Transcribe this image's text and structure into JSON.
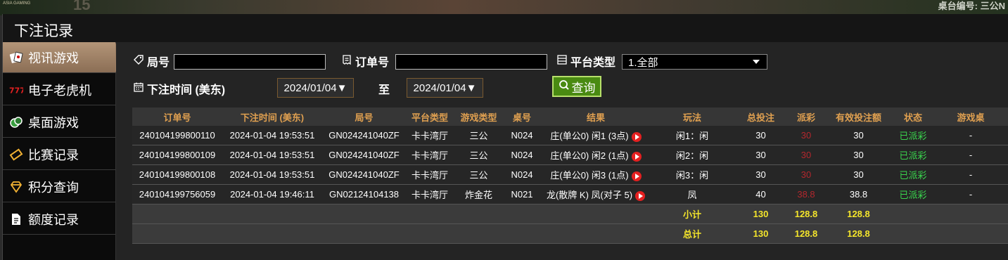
{
  "background": {
    "left_text": "ASIA GAMING",
    "number": "15",
    "right_text": "桌台编号: 三公N"
  },
  "window": {
    "title": "下注记录"
  },
  "sidebar": {
    "items": [
      {
        "label": "视讯游戏",
        "icon": "cards-icon",
        "active": true
      },
      {
        "label": "电子老虎机",
        "icon": "slot-777-icon",
        "active": false
      },
      {
        "label": "桌面游戏",
        "icon": "chip-icon",
        "active": false
      },
      {
        "label": "比赛记录",
        "icon": "ticket-icon",
        "active": false
      },
      {
        "label": "积分查询",
        "icon": "diamond-icon",
        "active": false
      },
      {
        "label": "额度记录",
        "icon": "document-icon",
        "active": false
      }
    ]
  },
  "filters": {
    "round_label": "局号",
    "round_value": "",
    "order_label": "订单号",
    "order_value": "",
    "platform_label": "平台类型",
    "platform_value": "1.全部",
    "time_label": "下注时间 (美东)",
    "date_from": "2024/01/04",
    "to_label": "至",
    "date_to": "2024/01/04",
    "query_label": "查询"
  },
  "table": {
    "headers": [
      "订单号",
      "下注时间 (美东)",
      "局号",
      "平台类型",
      "游戏类型",
      "桌号",
      "结果",
      "玩法",
      "总投注",
      "派彩",
      "有效投注额",
      "状态",
      "游戏桌"
    ],
    "rows": [
      [
        "240104199800110",
        "2024-01-04 19:53:51",
        "GN024241040ZF",
        "卡卡湾厅",
        "三公",
        "N024",
        "庄(单公0) 闲1 (3点)",
        "闲1：闲",
        "30",
        "30",
        "30",
        "已派彩",
        "-"
      ],
      [
        "240104199800109",
        "2024-01-04 19:53:51",
        "GN024241040ZF",
        "卡卡湾厅",
        "三公",
        "N024",
        "庄(单公0) 闲2 (1点)",
        "闲2：闲",
        "30",
        "30",
        "30",
        "已派彩",
        "-"
      ],
      [
        "240104199800108",
        "2024-01-04 19:53:51",
        "GN024241040ZF",
        "卡卡湾厅",
        "三公",
        "N024",
        "庄(单公0) 闲3 (1点)",
        "闲3：闲",
        "30",
        "30",
        "30",
        "已派彩",
        "-"
      ],
      [
        "240104199756059",
        "2024-01-04 19:46:11",
        "GN02124104138",
        "卡卡湾厅",
        "炸金花",
        "N021",
        "龙(散牌 K) 凤(对子 5)",
        "凤",
        "40",
        "38.8",
        "38.8",
        "已派彩",
        "-"
      ]
    ],
    "subtotal": {
      "label": "小计",
      "total_bet": "130",
      "payout": "128.8",
      "valid_bet": "128.8"
    },
    "total": {
      "label": "总计",
      "total_bet": "130",
      "payout": "128.8",
      "valid_bet": "128.8"
    }
  },
  "colors": {
    "header_text": "#e0a050",
    "payout_red": "#b3272d",
    "status_green": "#39d64d",
    "sum_yellow": "#f4e52b",
    "query_green": "#4a8a12"
  }
}
